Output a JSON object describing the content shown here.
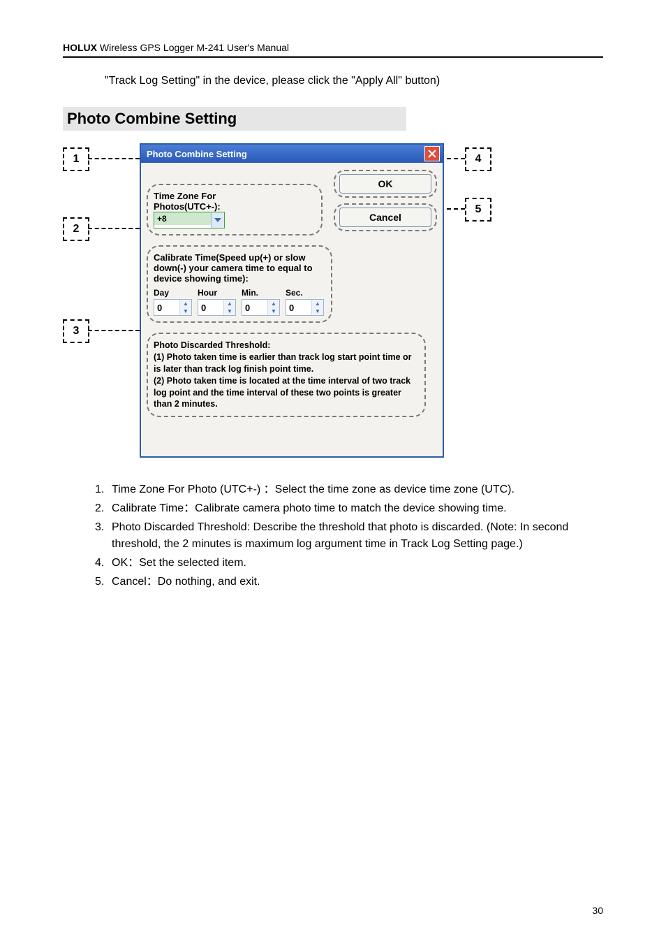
{
  "header": {
    "brand": "HOLUX",
    "rest": " Wireless GPS Logger M-241 User's Manual"
  },
  "intro": "\"Track Log Setting\" in the device, please click the \"Apply All\" button)",
  "section_title": "Photo Combine Setting",
  "dialog": {
    "title": "Photo Combine Setting",
    "ok": "OK",
    "cancel": "Cancel",
    "tz_label": "Time Zone For Photos(UTC+-):",
    "tz_value": "+8",
    "calibrate_title": "Calibrate Time(Speed up(+) or slow down(-) your camera time to equal to device showing time):",
    "col_day": "Day",
    "col_hour": "Hour",
    "col_min": "Min.",
    "col_sec": "Sec.",
    "val_day": "0",
    "val_hour": "0",
    "val_min": "0",
    "val_sec": "0",
    "threshold_title": "Photo Discarded Threshold:",
    "threshold_l1": "(1) Photo taken time is earlier than track log start point time or is later than track log finish point time.",
    "threshold_l2": "(2) Photo taken time is located at the time interval of two track log point and the time interval of these two points is greater than 2 minutes."
  },
  "callouts": {
    "c1": "1",
    "c2": "2",
    "c3": "3",
    "c4": "4",
    "c5": "5"
  },
  "list": {
    "n1": "1.",
    "t1": "Time Zone For Photo (UTC+-) ：Select the time zone as device time zone (UTC).",
    "n2": "2.",
    "t2": "Calibrate Time：Calibrate camera photo time to match the device showing time.",
    "n3": "3.",
    "t3": "Photo Discarded Threshold: Describe the threshold that photo is discarded. (Note: In second threshold, the 2 minutes is maximum log argument time in Track Log Setting page.)",
    "n4": "4.",
    "t4": "OK：Set the selected item.",
    "n5": "5.",
    "t5": "Cancel：Do nothing, and exit."
  },
  "page_number": "30"
}
